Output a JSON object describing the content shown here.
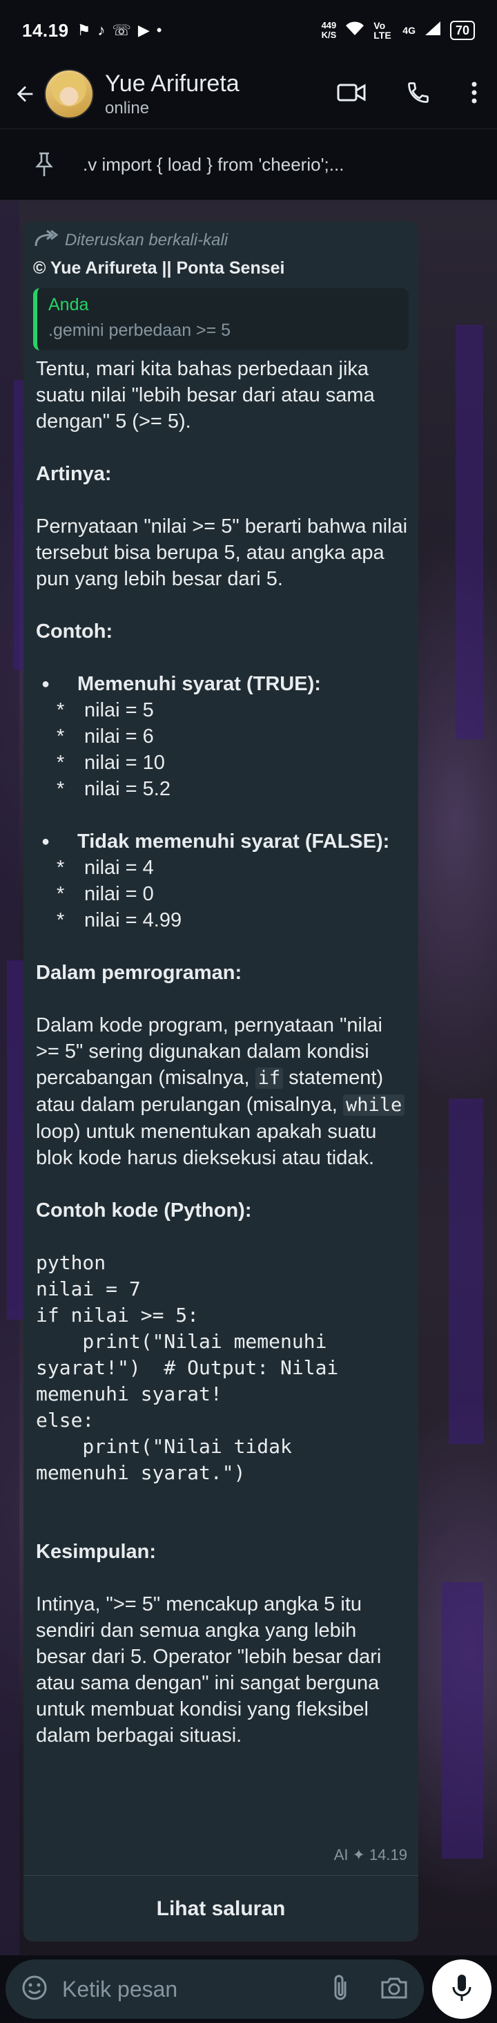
{
  "status_bar": {
    "time": "14.19",
    "net_speed_value": "449",
    "net_speed_unit": "K/S",
    "volte": "Vo LTE",
    "network": "4G",
    "battery": "70"
  },
  "header": {
    "contact_name": "Yue Arifureta",
    "contact_status": "online"
  },
  "pinned": {
    "text": ".v import { load } from 'cheerio';..."
  },
  "message": {
    "forwarded_label": "Diteruskan berkali-kali",
    "sender": "© Yue Arifureta || Ponta Sensei",
    "quote_author": "Anda",
    "quote_text": ".gemini perbedaan >= 5",
    "intro": "Tentu, mari kita bahas perbedaan jika suatu nilai \"lebih besar dari atau sama dengan\" 5 (>= 5).",
    "artinya_heading": "Artinya:",
    "artinya_text": "Pernyataan \"nilai >= 5\" berarti bahwa nilai tersebut bisa berupa 5, atau angka apa pun yang lebih besar dari 5.",
    "contoh_heading": "Contoh:",
    "true_title": "Memenuhi syarat (TRUE):",
    "true_items": [
      "nilai = 5",
      "nilai = 6",
      "nilai = 10",
      "nilai = 5.2"
    ],
    "false_title": "Tidak memenuhi syarat (FALSE):",
    "false_items": [
      "nilai = 4",
      "nilai = 0",
      "nilai = 4.99"
    ],
    "prog_heading": "Dalam pemrograman:",
    "prog_text_1": "Dalam kode program, pernyataan \"nilai >= 5\" sering digunakan dalam kondisi percabangan (misalnya, ",
    "prog_code_if": "if",
    "prog_text_2": " statement) atau dalam perulangan (misalnya, ",
    "prog_code_while": "while",
    "prog_text_3": " loop) untuk menentukan apakah suatu blok kode harus dieksekusi atau tidak.",
    "code_heading": "Contoh kode (Python):",
    "code_block": "python\nnilai = 7\nif nilai >= 5:\n    print(\"Nilai memenuhi\nsyarat!\")  # Output: Nilai\nmemenuhi syarat!\nelse:\n    print(\"Nilai tidak\nmemenuhi syarat.\")",
    "kesimpulan_heading": "Kesimpulan:",
    "kesimpulan_text": "Intinya, \">= 5\" mencakup angka 5 itu sendiri dan semua angka yang lebih besar dari 5. Operator \"lebih besar dari atau sama dengan\" ini sangat berguna untuk membuat kondisi yang fleksibel dalam berbagai situasi.",
    "ai_label": "AI",
    "time": "14.19",
    "channel_button": "Lihat saluran"
  },
  "input": {
    "placeholder": "Ketik pesan"
  }
}
